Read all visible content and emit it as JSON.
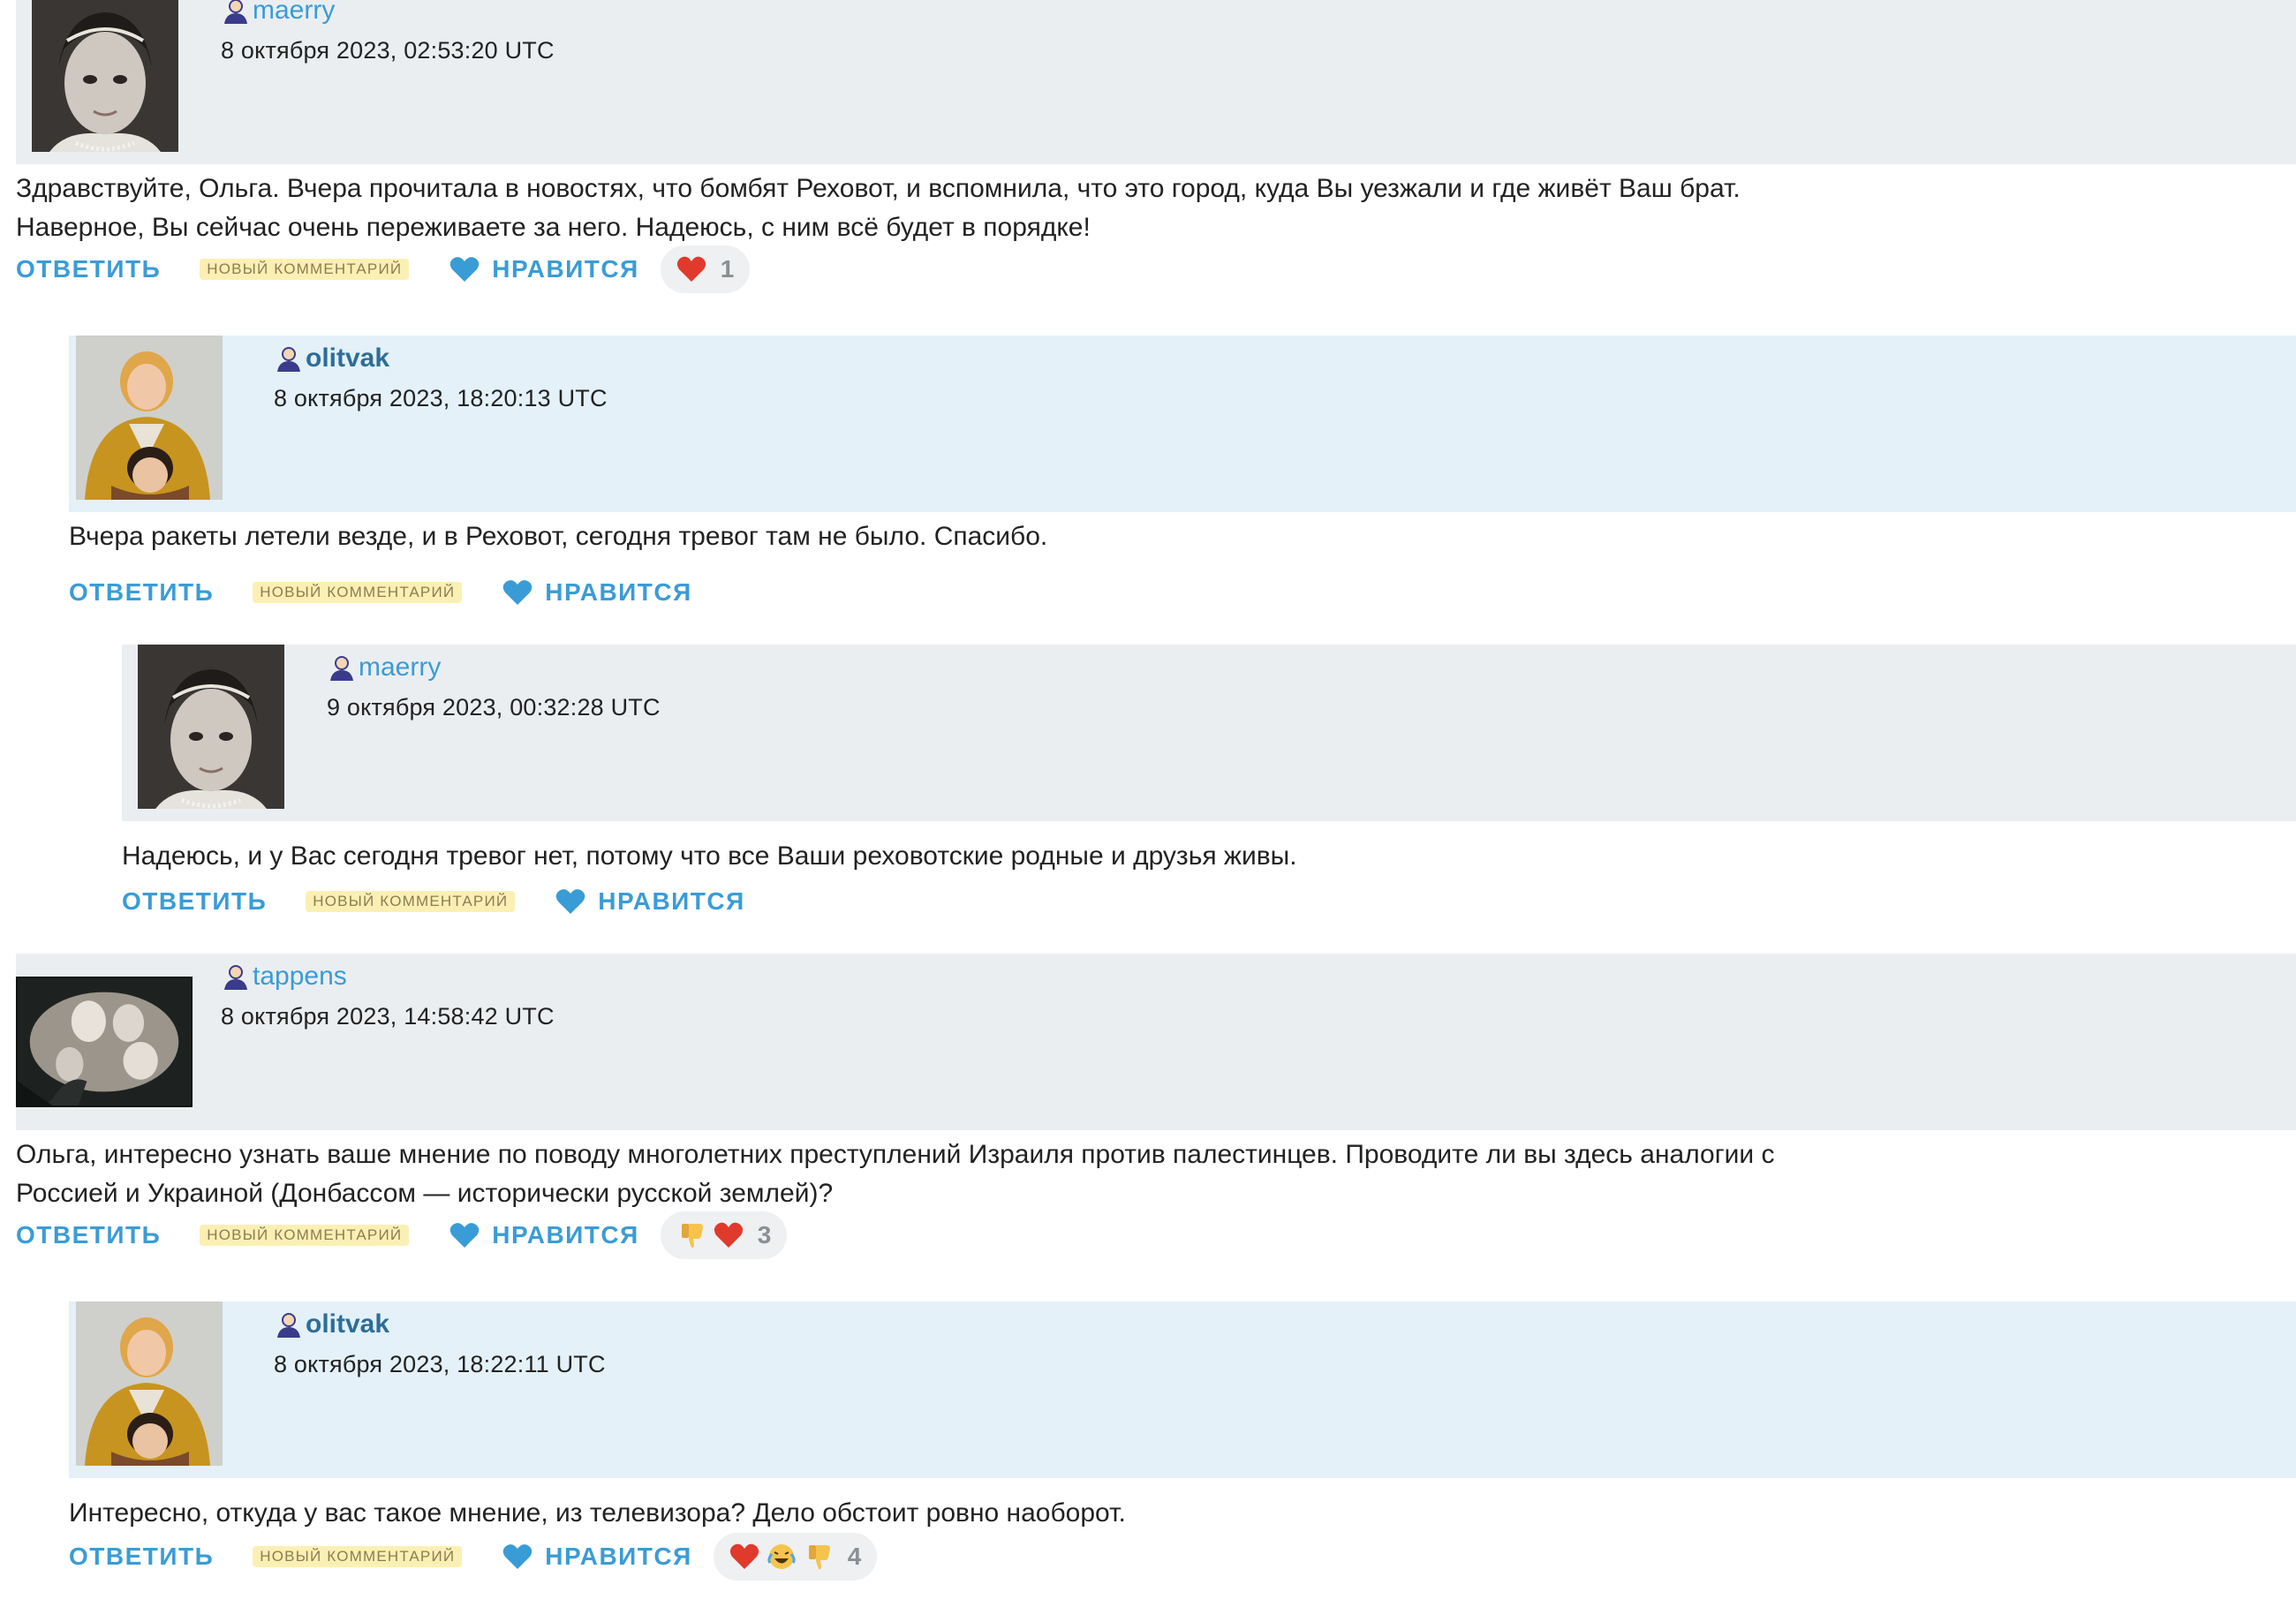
{
  "comments": [
    {
      "username": "maerry",
      "date": "8 октября 2023, 02:53:20 UTC",
      "text": "Здравствуйте, Ольга. Вчера прочитала в новостях, что бомбят Реховот, и вспомнила, что это город, куда Вы уезжали и где живёт Ваш брат.\nНаверное, Вы сейчас очень переживаете за него. Надеюсь, с ним всё будет в порядке!",
      "reply_label": "Ответить",
      "new_label": "Новый комментарий",
      "like_label": "Нравится",
      "reactions": [
        "heart-icon"
      ],
      "reaction_count": "1"
    },
    {
      "username": "olitvak",
      "date": "8 октября 2023, 18:20:13 UTC",
      "text": "Вчера ракеты летели везде, и в Реховот, сегодня тревог там не было. Спасибо.",
      "reply_label": "Ответить",
      "new_label": "Новый комментарий",
      "like_label": "Нравится"
    },
    {
      "username": "maerry",
      "date": "9 октября 2023, 00:32:28 UTC",
      "text": "Надеюсь, и у Вас сегодня тревог нет, потому что все Ваши реховотские родные и друзья живы.",
      "reply_label": "Ответить",
      "new_label": "Новый комментарий",
      "like_label": "Нравится"
    },
    {
      "username": "tappens",
      "date": "8 октября 2023, 14:58:42 UTC",
      "text": "Ольга, интересно узнать ваше мнение по поводу многолетних преступлений Израиля против палестинцев. Проводите ли вы здесь аналогии с\nРоссией и Украиной (Донбассом — исторически русской землей)?",
      "reply_label": "Ответить",
      "new_label": "Новый комментарий",
      "like_label": "Нравится",
      "reactions": [
        "thumbs-down-icon",
        "heart-icon"
      ],
      "reaction_count": "3"
    },
    {
      "username": "olitvak",
      "date": "8 октября 2023, 18:22:11 UTC",
      "text": "Интересно, откуда у вас такое мнение, из телевизора? Дело обстоит ровно наоборот.",
      "reply_label": "Ответить",
      "new_label": "Новый комментарий",
      "like_label": "Нравится",
      "reactions": [
        "heart-icon",
        "laughing-crying-icon",
        "thumbs-down-icon"
      ],
      "reaction_count": "4"
    }
  ],
  "colors": {
    "link": "#3a9cd6",
    "author_link": "#2d6e98",
    "header_bg": "#ebeef1",
    "author_header_bg": "#e4f1f8",
    "badge_bg": "#fbf0b4",
    "heart_red": "#e03a2c"
  }
}
